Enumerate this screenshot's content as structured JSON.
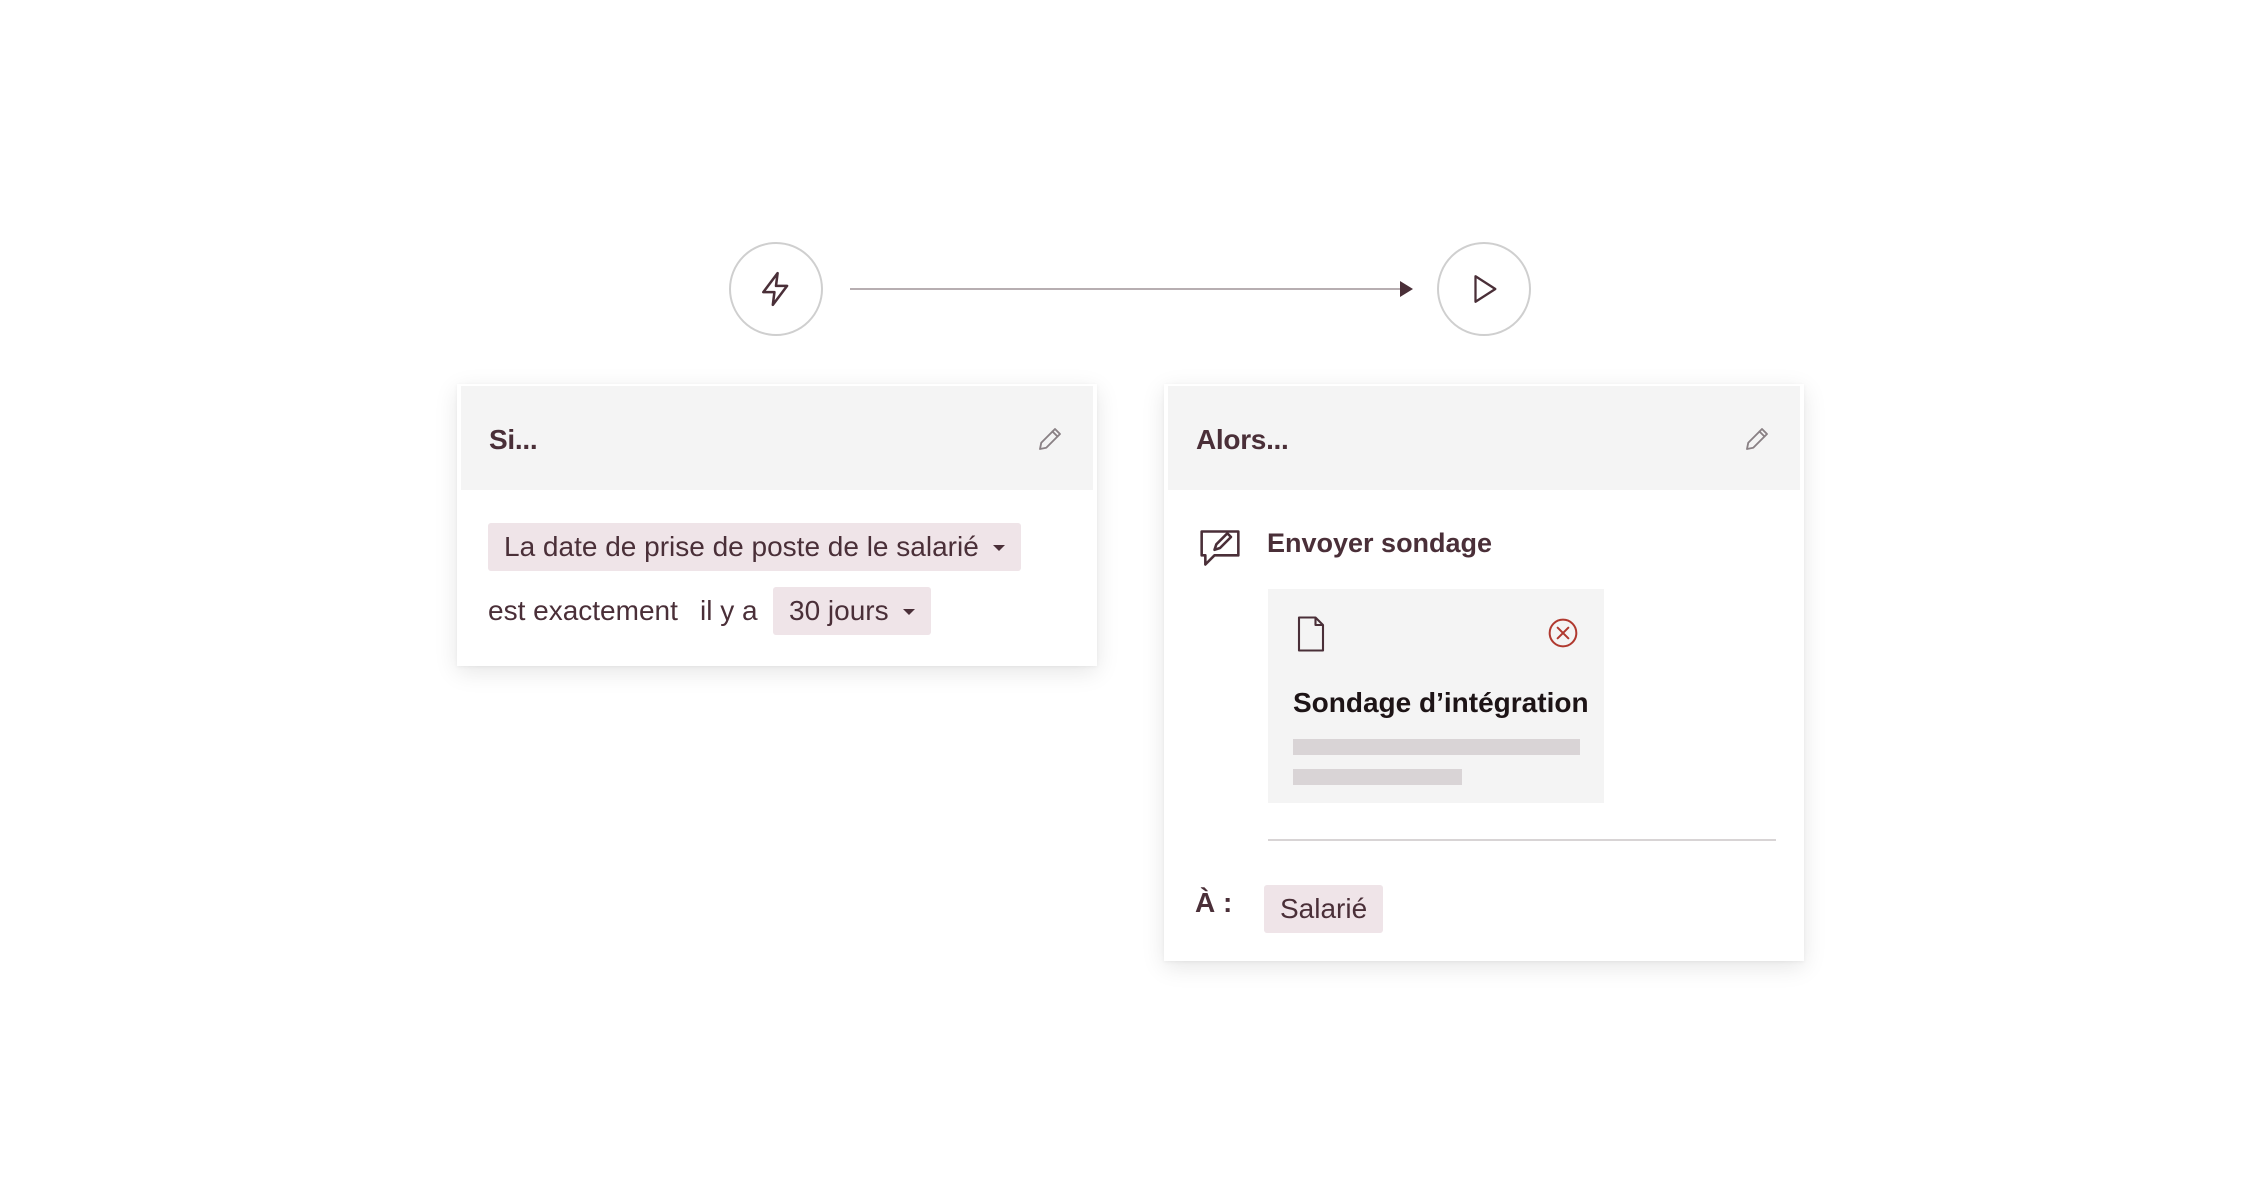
{
  "flow": {
    "trigger_icon": "lightning-icon",
    "action_icon": "play-icon"
  },
  "condition_card": {
    "title": "Si...",
    "edit_icon": "pencil-icon",
    "field_selector": "La date de prise de poste de le salarié",
    "operator_text": "est exactement",
    "relative_text": "il y a",
    "range_selector": "30 jours"
  },
  "action_card": {
    "title": "Alors...",
    "edit_icon": "pencil-icon",
    "action_icon": "survey-chat-icon",
    "action_label": "Envoyer sondage",
    "survey": {
      "icon": "document-icon",
      "remove_icon": "close-circle-icon",
      "name": "Sondage d’intégration"
    },
    "recipient_label": "À :",
    "recipient": "Salarié"
  },
  "colors": {
    "text": "#4a2f38",
    "chip_bg": "#efe4e8",
    "header_bg": "#f4f4f4",
    "remove_icon": "#b0392f",
    "node_border": "#cfcfcf"
  }
}
